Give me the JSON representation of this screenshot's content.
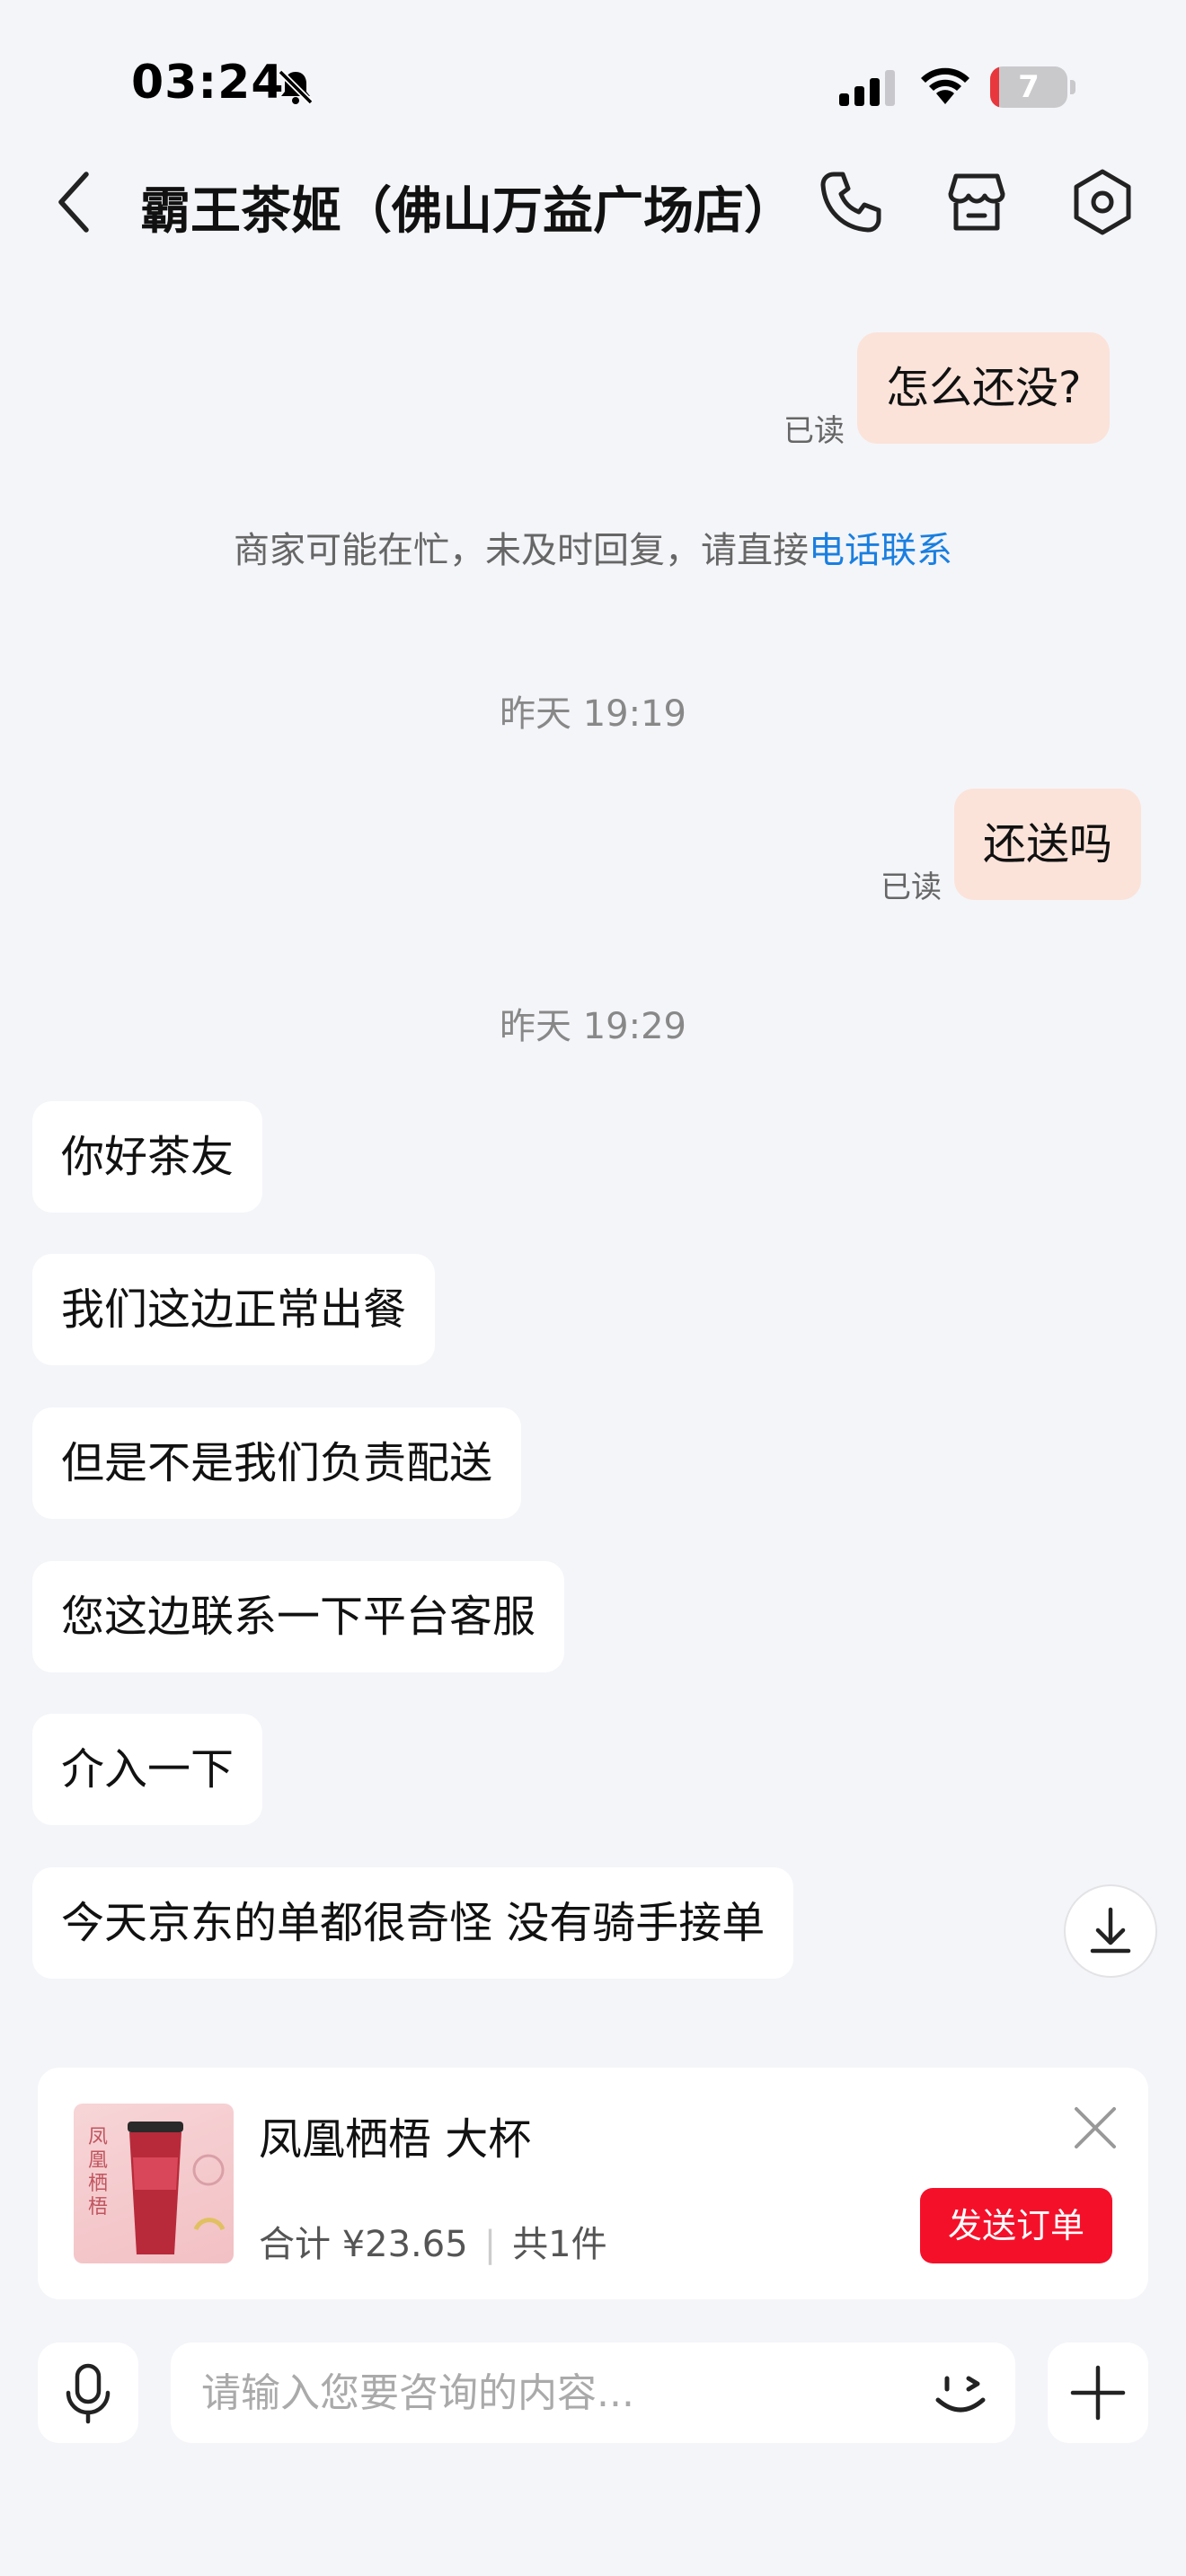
{
  "status_bar": {
    "time": "03:24",
    "battery": "7"
  },
  "header": {
    "title": "霸王茶姬（佛山万益广场店）"
  },
  "messages": {
    "out_1": {
      "text": "怎么还没?",
      "read": "已读"
    },
    "notice": {
      "prefix": "商家可能在忙，未及时回复，请直接",
      "link": "电话联系"
    },
    "time_1": "昨天 19:19",
    "out_2": {
      "text": "还送吗",
      "read": "已读"
    },
    "time_2": "昨天 19:29",
    "in": [
      "你好茶友",
      "我们这边正常出餐",
      "但是不是我们负责配送",
      "您这边联系一下平台客服",
      "介入一下",
      "今天京东的单都很奇怪 没有骑手接单"
    ]
  },
  "order": {
    "product_name": "凤凰栖梧 大杯",
    "total": "合计 ¥23.65",
    "count": "共1件",
    "send_label": "发送订单",
    "image_caption": "凤凰栖梧"
  },
  "input": {
    "placeholder": "请输入您要咨询的内容..."
  },
  "colors": {
    "accent_red": "#f5102a",
    "link_blue": "#1a7fe0",
    "outgoing_bubble": "#fbe3da"
  }
}
